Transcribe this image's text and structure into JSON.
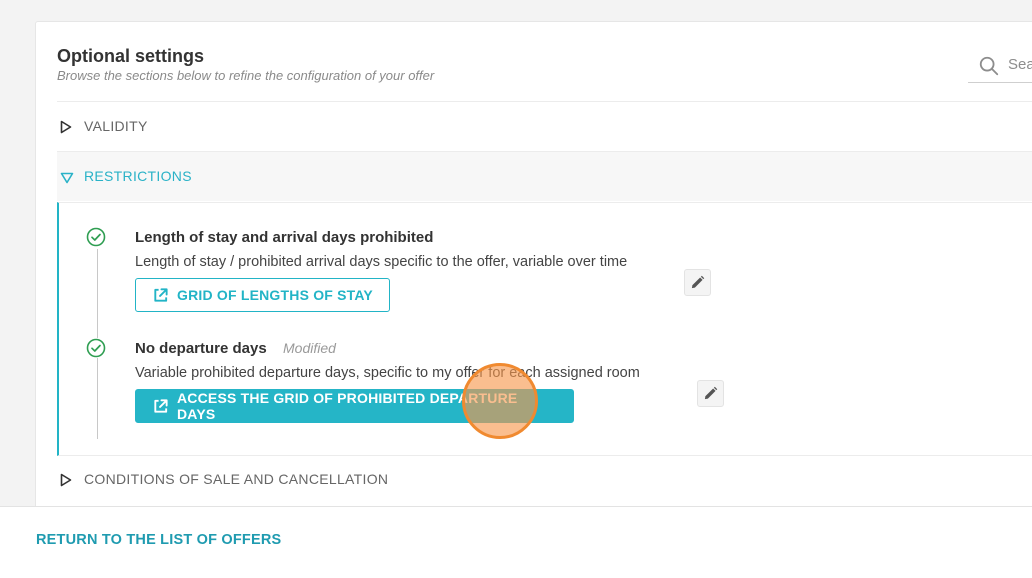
{
  "page": {
    "title": "Optional settings",
    "subtitle": "Browse the sections below to refine the configuration of your offer",
    "search_placeholder": "Search"
  },
  "sections": [
    {
      "label": "VALIDITY",
      "state": "collapsed"
    },
    {
      "label": "RESTRICTIONS",
      "state": "expanded"
    },
    {
      "label": "CONDITIONS OF SALE AND CANCELLATION",
      "state": "collapsed"
    }
  ],
  "restrictions": {
    "items": [
      {
        "title": "Length of stay and arrival days prohibited",
        "modified": "",
        "description": "Length of stay / prohibited arrival days specific to the offer, variable over time",
        "button_label": "GRID OF LENGTHS OF STAY",
        "status_icon": "check-circle-icon",
        "edit_icon": "pencil-icon"
      },
      {
        "title": "No departure days",
        "modified": "Modified",
        "description": "Variable prohibited departure days, specific to my offer for each assigned room",
        "button_label": "ACCESS THE GRID OF PROHIBITED DEPARTURE DAYS",
        "status_icon": "check-circle-icon",
        "edit_icon": "pencil-icon"
      }
    ]
  },
  "footer": {
    "return_label": "RETURN TO THE LIST OF OFFERS"
  },
  "colors": {
    "accent": "#22b4c6",
    "success": "#2f9e52",
    "link": "#1f9bb0",
    "cursor": "#f08a30"
  }
}
